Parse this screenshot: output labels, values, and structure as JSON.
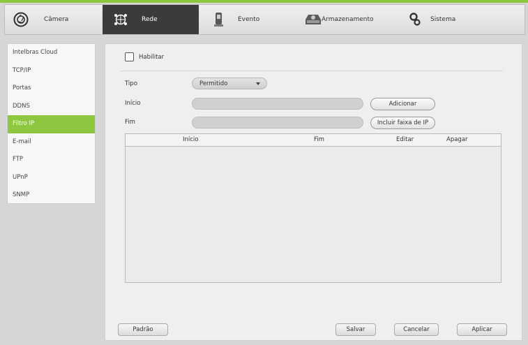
{
  "nav": {
    "tabs": [
      {
        "label": "Câmera",
        "icon": "camera-lens-icon"
      },
      {
        "label": "Rede",
        "icon": "network-globe-icon",
        "active": true
      },
      {
        "label": "Evento",
        "icon": "event-icon"
      },
      {
        "label": "Armazenamento",
        "icon": "storage-hdd-icon"
      },
      {
        "label": "Sistema",
        "icon": "gears-icon"
      }
    ]
  },
  "sidebar": {
    "items": [
      {
        "label": "Intelbras Cloud"
      },
      {
        "label": "TCP/IP"
      },
      {
        "label": "Portas"
      },
      {
        "label": "DDNS"
      },
      {
        "label": "Filtro IP",
        "active": true
      },
      {
        "label": "E-mail"
      },
      {
        "label": "FTP"
      },
      {
        "label": "UPnP"
      },
      {
        "label": "SNMP"
      }
    ]
  },
  "form": {
    "enable_label": "Habilitar",
    "enable_checked": false,
    "tipo_label": "Tipo",
    "tipo_value": "Permitido",
    "inicio_label": "Início",
    "inicio_value": "",
    "fim_label": "Fim",
    "fim_value": "",
    "add_button": "Adicionar",
    "range_button": "Incluir faixa de IP"
  },
  "table": {
    "columns": [
      "Início",
      "Fim",
      "Editar",
      "Apagar"
    ],
    "rows": []
  },
  "footer": {
    "default_button": "Padrão",
    "save_button": "Salvar",
    "cancel_button": "Cancelar",
    "apply_button": "Aplicar"
  },
  "colors": {
    "accent": "#8dc63f",
    "active_tab": "#3b3b3b"
  }
}
